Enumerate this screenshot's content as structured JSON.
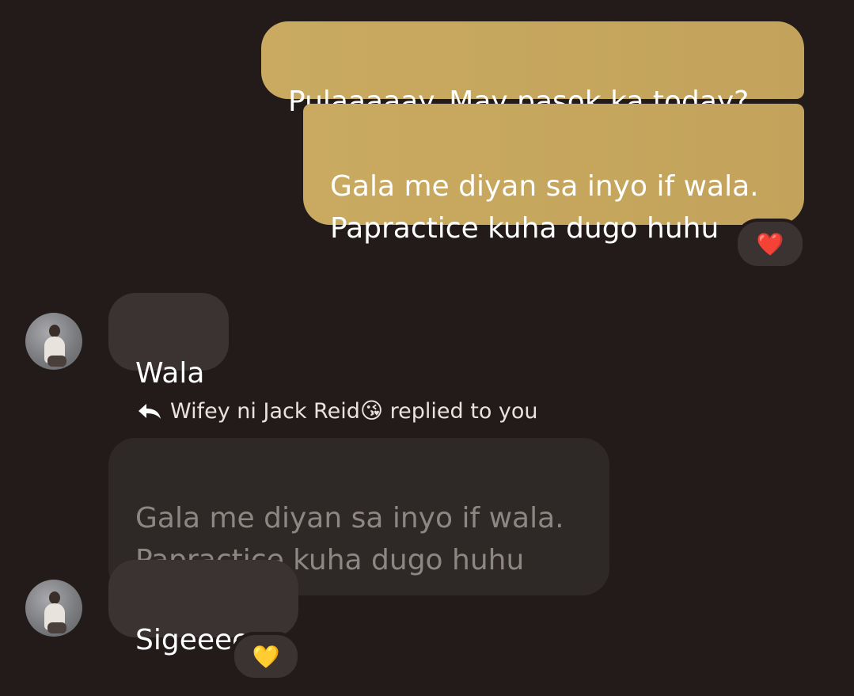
{
  "messages": {
    "sent_1": "Pulaaaaay. May pasok ka today?",
    "sent_2": "Gala me diyan sa inyo if wala.\nPapractice kuha dugo huhu",
    "sent_2_reaction": "❤️",
    "recv_1": "Wala",
    "reply_header": "Wifey ni Jack Reid",
    "reply_header_emoji": "😘",
    "reply_header_suffix": "replied to you",
    "quoted": "Gala me diyan sa inyo if wala.\nPapractice kuha dugo huhu",
    "recv_2": "Sigeeeee",
    "recv_2_reaction": "💛"
  },
  "icons": {
    "reply": "reply-arrow-icon",
    "avatar": "contact-avatar"
  },
  "colors": {
    "background": "#221b1a",
    "sent_bubble": "#c9aa60",
    "received_bubble": "#3a3332",
    "quoted_text": "#8d8784"
  }
}
